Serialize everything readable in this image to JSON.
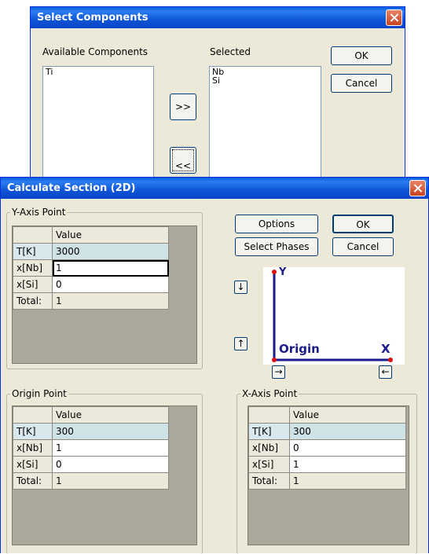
{
  "select_components": {
    "title": "Select Components",
    "available_label": "Available Components",
    "available_items": [
      "Ti"
    ],
    "selected_label": "Selected",
    "selected_items": [
      "Nb",
      "Si"
    ],
    "add_button": ">>",
    "remove_button": "<<",
    "ok_button": "OK",
    "cancel_button": "Cancel"
  },
  "calc_section": {
    "title": "Calculate Section (2D)",
    "options_button": "Options",
    "ok_button": "OK",
    "select_phases_button": "Select Phases",
    "cancel_button": "Cancel",
    "y_axis_group": "Y-Axis Point",
    "origin_group": "Origin Point",
    "x_axis_group": "X-Axis Point",
    "value_header": "Value",
    "y_axis_rows": [
      {
        "label": "T[K]",
        "value": "3000"
      },
      {
        "label": "x[Nb]",
        "value": "1"
      },
      {
        "label": "x[Si]",
        "value": "0"
      },
      {
        "label": "Total:",
        "value": "1"
      }
    ],
    "origin_rows": [
      {
        "label": "T[K]",
        "value": "300"
      },
      {
        "label": "x[Nb]",
        "value": "1"
      },
      {
        "label": "x[Si]",
        "value": "0"
      },
      {
        "label": "Total:",
        "value": "1"
      }
    ],
    "x_axis_rows": [
      {
        "label": "T[K]",
        "value": "300"
      },
      {
        "label": "x[Nb]",
        "value": "0"
      },
      {
        "label": "x[Si]",
        "value": "1"
      },
      {
        "label": "Total:",
        "value": "1"
      }
    ],
    "diagram": {
      "y_label": "Y",
      "origin_label": "Origin",
      "x_label": "X",
      "axis_color": "#1b1b8c",
      "point_color": "#e01010"
    },
    "arrows": {
      "down": "↓",
      "up": "↑",
      "right": "→",
      "left": "←"
    }
  }
}
